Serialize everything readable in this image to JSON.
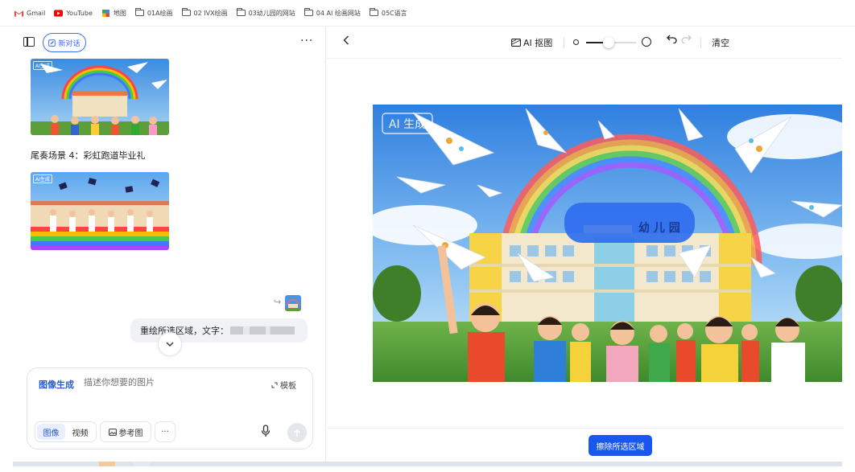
{
  "bookmarks": [
    {
      "label": "Gmail",
      "icon": "gmail-icon"
    },
    {
      "label": "YouTube",
      "icon": "youtube-icon"
    },
    {
      "label": "地图",
      "icon": "maps-icon"
    },
    {
      "label": "01A绘画",
      "icon": "folder-icon"
    },
    {
      "label": "02 IVX绘画",
      "icon": "folder-icon"
    },
    {
      "label": "03幼儿园的网站",
      "icon": "folder-icon"
    },
    {
      "label": "04 AI 绘画网站",
      "icon": "folder-icon"
    },
    {
      "label": "05C语言",
      "icon": "folder-icon"
    }
  ],
  "left": {
    "new_chat_label": "新对话",
    "more_label": "···",
    "caption": "尾奏场景 4：彩虹跑道毕业礼",
    "ai_tag": "AI生成",
    "bubble_text": "重绘所选区域，文字：",
    "composer": {
      "mode": "图像生成",
      "placeholder": "描述你想要的图片",
      "template_label": "模板",
      "tab_image": "图像",
      "tab_video": "视频",
      "ref_label": "参考图",
      "more_label": "···"
    }
  },
  "right": {
    "ai_cutout_label": "AI 抠图",
    "clear_label": "清空",
    "image_watermark": "AI 生成",
    "banner_text": "幼 儿 园",
    "erase_button": "擦除所选区域",
    "brush_size_fraction": 0.45
  },
  "colors": {
    "accent": "#1a56f0",
    "link_blue": "#3b6cf6"
  }
}
